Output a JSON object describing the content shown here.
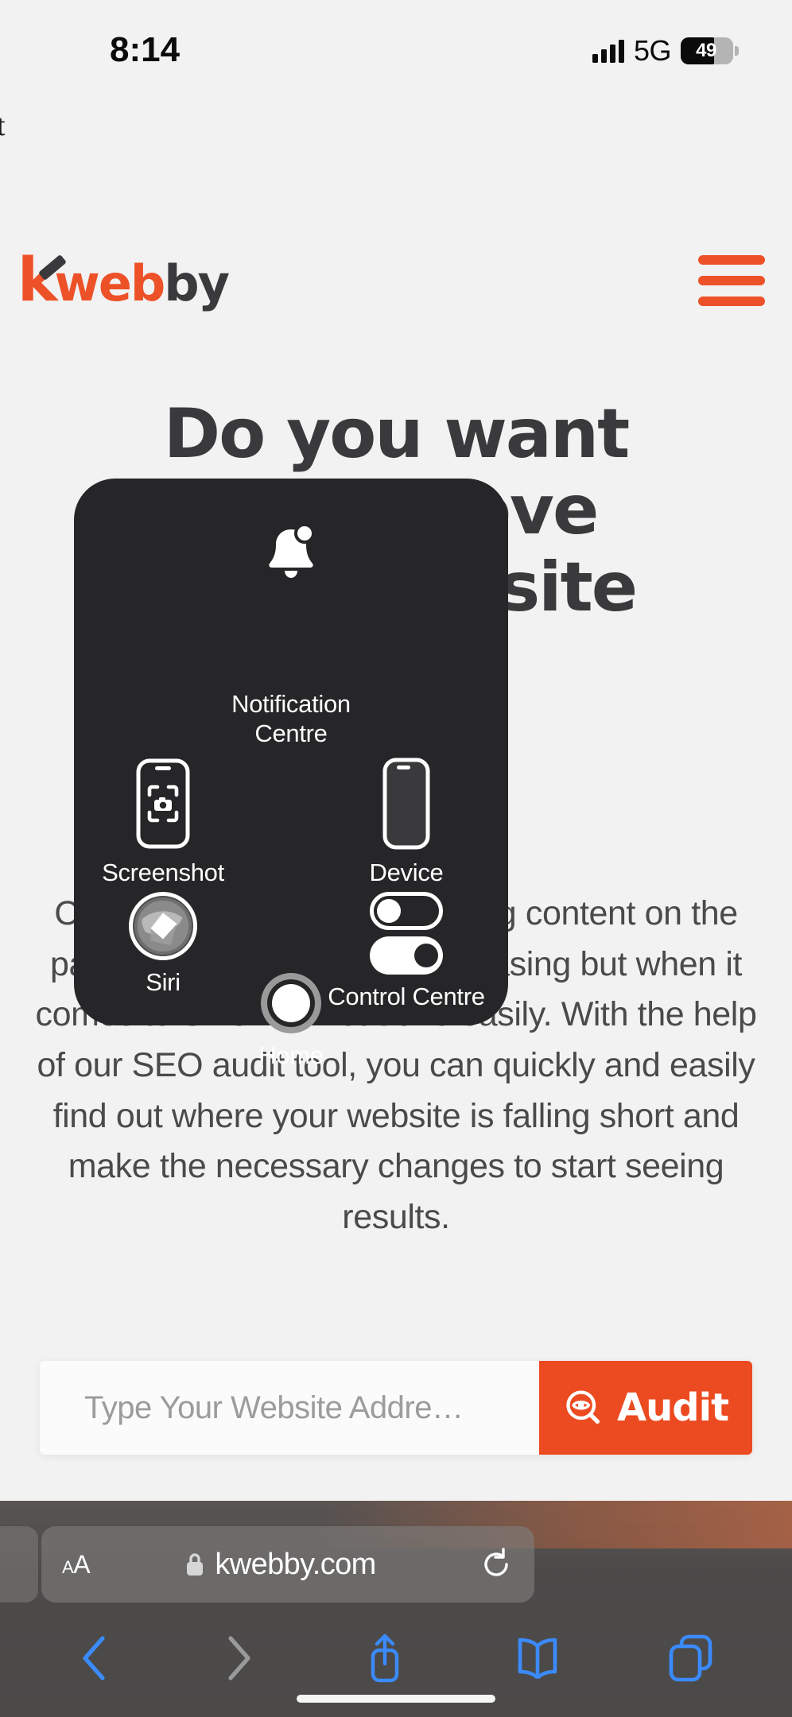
{
  "status_bar": {
    "time": "8:14",
    "network": "5G",
    "battery_percent": "49",
    "signal_icon": "cellular-bars-icon",
    "battery_icon": "battery-icon"
  },
  "stray_text": "t",
  "site_header": {
    "logo": {
      "k": "k",
      "web": "web",
      "by": "by",
      "full": "kwebby"
    },
    "menu_icon": "hamburger-menu-icon"
  },
  "hero": {
    "title_line1": "Do you want",
    "title_line2": "to improve",
    "title_line3": "your website",
    "paragraph": "Choosing keywords, optimizing content on the page, building links, and increasing but when it comes to SEO it is not done easily. With the help of our SEO audit tool, you can quickly and easily find out where your website is falling short and make the necessary changes to start seeing results.",
    "paragraph_visible_tail": "SEO audit tool, you can quickly and easily find out where your website is falling short and make the necessary changes to start seeing results."
  },
  "audit_form": {
    "placeholder": "Type Your Website Addre…",
    "value": "",
    "button_label": "Audit",
    "button_icon": "eye-target-icon",
    "button_color": "#ec4a20"
  },
  "assistive_touch": {
    "panel_name": "assistive-touch-menu",
    "items": [
      {
        "id": "notification-centre",
        "label": "Notification Centre",
        "icon": "bell-icon"
      },
      {
        "id": "screenshot",
        "label": "Screenshot",
        "icon": "screenshot-icon"
      },
      {
        "id": "device",
        "label": "Device",
        "icon": "device-icon"
      },
      {
        "id": "siri",
        "label": "Siri",
        "icon": "siri-icon"
      },
      {
        "id": "control-centre",
        "label": "Control Centre",
        "icon": "toggles-icon"
      },
      {
        "id": "home",
        "label": "Home",
        "icon": "home-button-icon"
      }
    ],
    "background_color": "#262628"
  },
  "safari": {
    "text_size_label": "AA",
    "lock_icon": "lock-icon",
    "url": "kwebby.com",
    "reload_icon": "reload-icon",
    "toolbar": [
      {
        "id": "back",
        "icon": "chevron-left-icon",
        "state": "enabled"
      },
      {
        "id": "forward",
        "icon": "chevron-right-icon",
        "state": "disabled"
      },
      {
        "id": "share",
        "icon": "share-icon",
        "state": "enabled"
      },
      {
        "id": "bookmarks",
        "icon": "book-icon",
        "state": "enabled"
      },
      {
        "id": "tabs",
        "icon": "tabs-icon",
        "state": "enabled"
      }
    ],
    "accent_color": "#3b8bff"
  }
}
